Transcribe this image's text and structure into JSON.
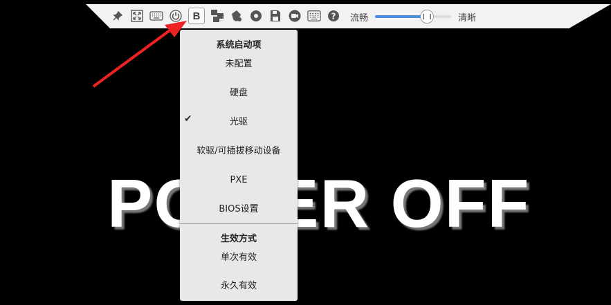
{
  "screen": {
    "big_text": "POWER OFF",
    "background_color": "#000000"
  },
  "toolbar": {
    "icons": [
      "pin-icon",
      "fullscreen-icon",
      "keyboard-icon",
      "power-icon",
      "boot-icon",
      "ctrl-alt-del-icon",
      "mouse-icon",
      "record-icon",
      "save-icon",
      "video-icon",
      "virtual-keyboard-icon",
      "help-icon"
    ],
    "active_icon": "boot-icon",
    "boot_letter": "B",
    "quality": {
      "left_label": "流畅",
      "right_label": "清晰",
      "value_fraction": 0.68,
      "accent_color": "#4a90e2"
    }
  },
  "boot_menu": {
    "section1_title": "系统启动项",
    "items": [
      {
        "label": "未配置",
        "checked": false
      },
      {
        "label": "硬盘",
        "checked": false
      },
      {
        "label": "光驱",
        "checked": true
      },
      {
        "label": "软驱/可插拔移动设备",
        "checked": false
      },
      {
        "label": "PXE",
        "checked": false
      },
      {
        "label": "BIOS设置",
        "checked": false
      }
    ],
    "section2_title": "生效方式",
    "mode_items": [
      {
        "label": "单次有效"
      },
      {
        "label": "永久有效"
      }
    ],
    "check_glyph": "✔"
  },
  "annotation": {
    "arrow_color": "#ee2222"
  }
}
